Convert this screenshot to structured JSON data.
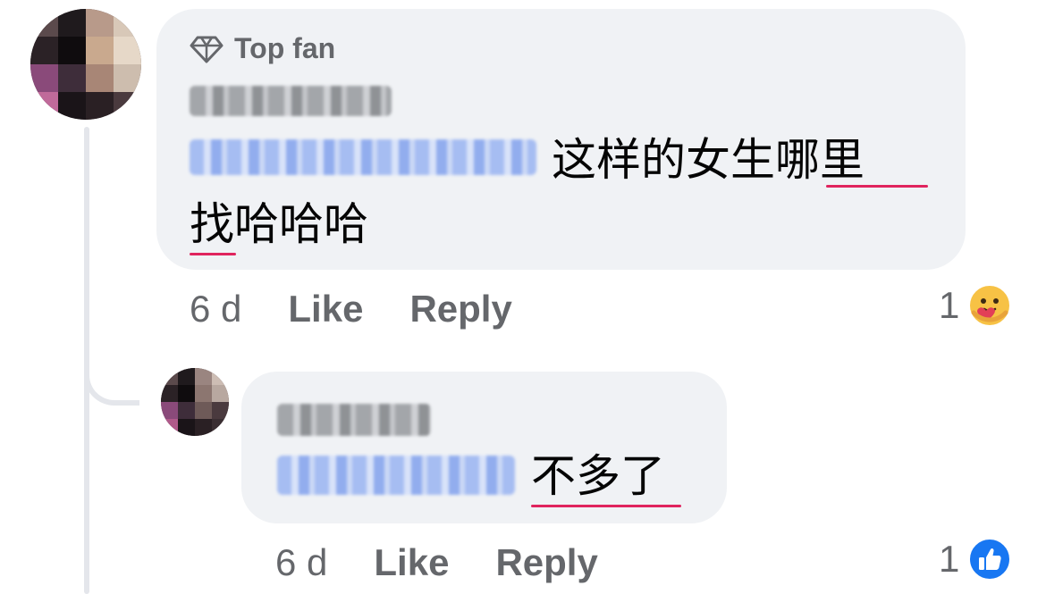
{
  "comment1": {
    "badge_label": "Top fan",
    "body_text_line1": "这样的女生哪里",
    "body_text_line2": "找哈哈哈",
    "time": "6 d",
    "like_label": "Like",
    "reply_label": "Reply",
    "reaction_count": "1",
    "reaction_icon": "care-reaction-icon"
  },
  "comment2": {
    "body_text": "不多了",
    "time": "6 d",
    "like_label": "Like",
    "reply_label": "Reply",
    "reaction_count": "1",
    "reaction_icon": "like-reaction-icon"
  },
  "colors": {
    "bubble": "#f0f2f5",
    "secondary_text": "#65676b",
    "like_blue": "#1877f2",
    "spell_underline": "#e0245e"
  }
}
